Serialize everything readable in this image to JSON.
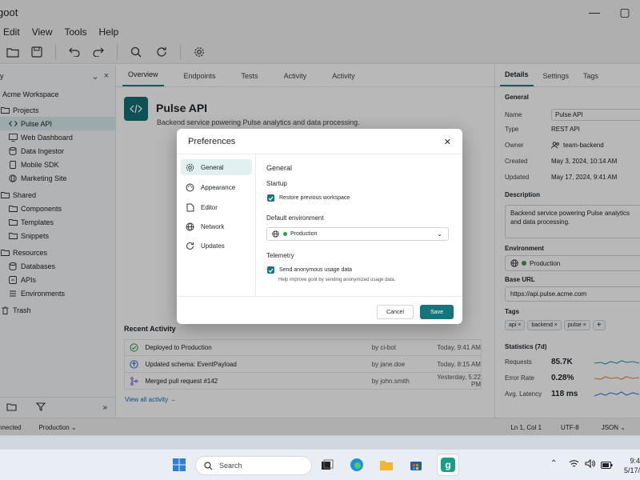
{
  "window": {
    "title": "goot",
    "controls": [
      "—",
      "▢"
    ]
  },
  "menu": [
    "Edit",
    "View",
    "Tools",
    "Help"
  ],
  "sidebar": {
    "header_label": "y",
    "workspace": "Acme Workspace",
    "items": [
      {
        "label": "Projects",
        "indent": 0,
        "icon": "folder-icon"
      },
      {
        "label": "Pulse API",
        "indent": 1,
        "icon": "code-icon",
        "active": true
      },
      {
        "label": "Web Dashboard",
        "indent": 1,
        "icon": "monitor-icon"
      },
      {
        "label": "Data Ingestor",
        "indent": 1,
        "icon": "database-icon"
      },
      {
        "label": "Mobile SDK",
        "indent": 1,
        "icon": "phone-icon"
      },
      {
        "label": "Marketing Site",
        "indent": 1,
        "icon": "globe-icon"
      },
      {
        "label": "Shared",
        "indent": 0,
        "icon": "folder-icon"
      },
      {
        "label": "Components",
        "indent": 1,
        "icon": "folder-icon"
      },
      {
        "label": "Templates",
        "indent": 1,
        "icon": "folder-icon"
      },
      {
        "label": "Snippets",
        "indent": 1,
        "icon": "folder-icon"
      },
      {
        "label": "Resources",
        "indent": 0,
        "icon": "folder-icon"
      },
      {
        "label": "Databases",
        "indent": 1,
        "icon": "database-icon"
      },
      {
        "label": "APIs",
        "indent": 1,
        "icon": "api-icon"
      },
      {
        "label": "Environments",
        "indent": 1,
        "icon": "list-icon"
      },
      {
        "label": "Trash",
        "indent": 0,
        "icon": "trash-icon"
      }
    ]
  },
  "tabs": [
    "Overview",
    "Endpoints",
    "Tests",
    "Activity",
    "Activity"
  ],
  "project": {
    "title": "Pulse API",
    "description": "Backend service powering Pulse analytics and data processing."
  },
  "recent": {
    "title": "Recent Activity",
    "rows": [
      {
        "text": "Deployed to Production",
        "by": "by ci-bot",
        "time": "Today, 9:41 AM",
        "icon": "check-circle-icon"
      },
      {
        "text": "Updated schema: EventPayload",
        "by": "by jane.doe",
        "time": "Today, 8:15 AM",
        "icon": "upload-icon"
      },
      {
        "text": "Merged pull request #142",
        "by": "by john.smith",
        "time": "Yesterday, 5:22 PM",
        "icon": "merge-icon"
      }
    ],
    "view_all": "View all activity →"
  },
  "details": {
    "tabs": [
      "Details",
      "Settings",
      "Tags"
    ],
    "general_title": "General",
    "name_label": "Name",
    "name_value": "Pulse API",
    "type_label": "Type",
    "type_value": "REST API",
    "owner_label": "Owner",
    "owner_value": "team-backend",
    "created_label": "Created",
    "created_value": "May 3, 2024, 10:14 AM",
    "updated_label": "Updated",
    "updated_value": "May 17, 2024, 9:41 AM",
    "description_title": "Description",
    "description_value": "Backend service powering Pulse analytics and data processing.",
    "environment_title": "Environment",
    "environment_value": "Production",
    "base_url_title": "Base URL",
    "base_url_value": "https://api.pulse.acme.com",
    "tags_title": "Tags",
    "tags": [
      "api",
      "backend",
      "pulse"
    ],
    "stats_title": "Statistics (7d)",
    "stats": [
      {
        "label": "Requests",
        "value": "85.7K",
        "color": "#1f9aa8"
      },
      {
        "label": "Error Rate",
        "value": "0.28%",
        "color": "#e8833a"
      },
      {
        "label": "Avg. Latency",
        "value": "118 ms",
        "color": "#3b7bd6"
      }
    ]
  },
  "status": {
    "connection": "nnected",
    "environment": "Production",
    "cursor": "Ln 1, Col 1",
    "encoding": "UTF-8",
    "format": "JSON"
  },
  "dialog": {
    "title": "Preferences",
    "nav": [
      "General",
      "Appearance",
      "Editor",
      "Network",
      "Updates"
    ],
    "section_title": "General",
    "startup_title": "Startup",
    "restore_label": "Restore previous workspace",
    "default_env_title": "Default environment",
    "default_env_value": "Production",
    "telemetry_title": "Telemetry",
    "telemetry_label": "Send anonymous usage data",
    "telemetry_hint": "Help improve goot by sending anonymized usage data.",
    "cancel_label": "Cancel",
    "save_label": "Save"
  },
  "taskbar": {
    "search_placeholder": "Search",
    "time": "9:4",
    "date": "5/17/"
  },
  "colors": {
    "accent": "#17767d",
    "status_green": "#2e9e4f"
  }
}
